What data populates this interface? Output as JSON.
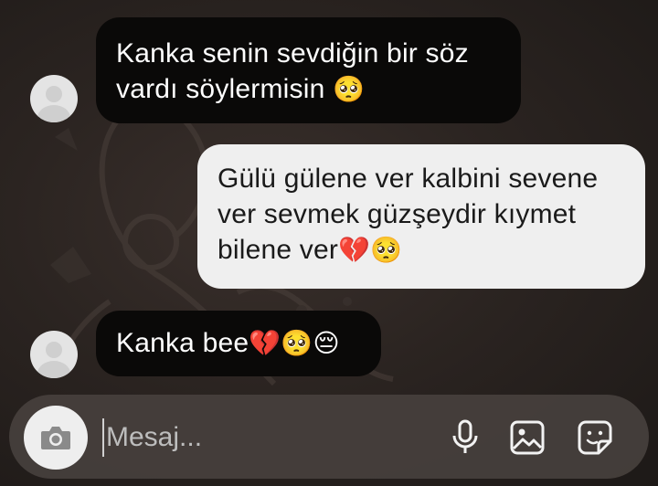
{
  "messages": [
    {
      "direction": "in",
      "lines": [
        "Kanka senin sevdiğin bir söz",
        "vardı söylermisin"
      ],
      "emoji": "🥺"
    },
    {
      "direction": "out",
      "lines": [
        "Gülü gülene ver kalbini sevene",
        "ver sevmek güzşeydir kıymet",
        "bilene ver"
      ],
      "emoji": "💔🥺"
    },
    {
      "direction": "in",
      "lines": [
        "Kanka bee"
      ],
      "emoji": "💔🥺😔"
    }
  ],
  "composer": {
    "placeholder": "Mesaj...",
    "icons": [
      "camera-icon",
      "microphone-icon",
      "gallery-icon",
      "sticker-icon"
    ]
  },
  "colors": {
    "incoming_bubble": "#0a0908",
    "outgoing_bubble": "#efefef",
    "composer_bg": "#46403d"
  }
}
